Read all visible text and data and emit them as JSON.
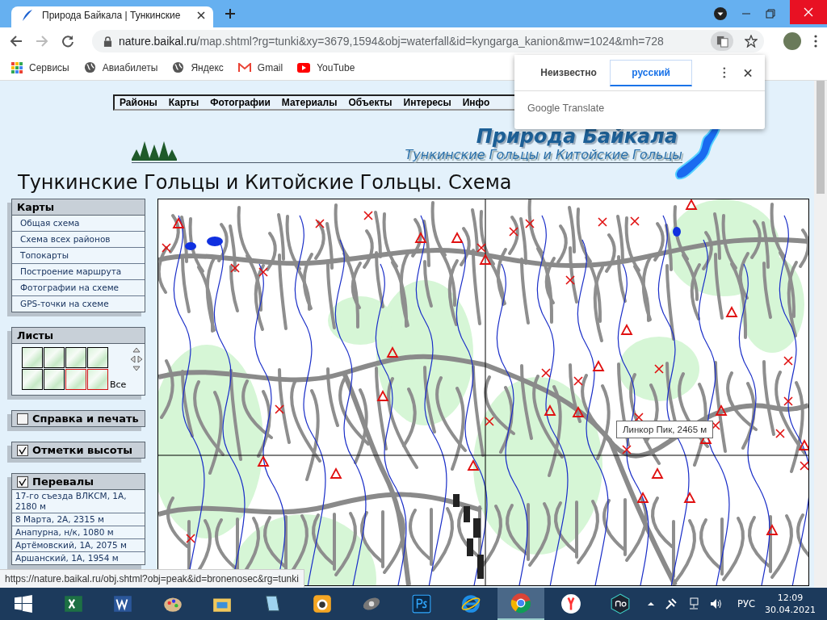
{
  "browser": {
    "tab": {
      "title": "Природа Байкала | Тункинские"
    },
    "url": {
      "host": "nature.baikal.ru",
      "path": "/map.shtml?rg=tunki&xy=3679,1594&obj=waterfall&id=kyngarga_kanion&mw=1024&mh=728"
    },
    "bookmarks": [
      {
        "label": "Сервисы",
        "kind": "apps"
      },
      {
        "label": "Авиабилеты",
        "kind": "globe"
      },
      {
        "label": "Яндекс",
        "kind": "globe"
      },
      {
        "label": "Gmail",
        "kind": "gmail"
      },
      {
        "label": "YouTube",
        "kind": "youtube"
      }
    ],
    "translate": {
      "languages": [
        {
          "label": "Неизвестно",
          "selected": false
        },
        {
          "label": "русский",
          "selected": true
        }
      ],
      "brand": "Google Translate"
    }
  },
  "page": {
    "menu": [
      "Районы",
      "Карты",
      "Фотографии",
      "Материалы",
      "Объекты",
      "Интересы",
      "Инфо"
    ],
    "site_title": "Природа Байкала",
    "site_subtitle": "Тункинские Гольцы и Китойские Гольцы",
    "heading": "Тункинские Гольцы и Китойские Гольцы. Схема",
    "sidebar": {
      "maps": {
        "title": "Карты",
        "items": [
          "Общая схема",
          "Схема всех районов",
          "Топокарты",
          "Построение маршрута",
          "Фотографии на схеме",
          "GPS-точки на схеме"
        ]
      },
      "sheets": {
        "title": "Листы",
        "all_label": "Все",
        "tiles": [
          {
            "selected": false
          },
          {
            "selected": false
          },
          {
            "selected": false
          },
          {
            "selected": false
          },
          {
            "selected": false
          },
          {
            "selected": false
          },
          {
            "selected": true
          },
          {
            "selected": true
          }
        ]
      },
      "toggles": [
        {
          "label": "Справка и печать",
          "checked": false
        },
        {
          "label": "Отметки высоты",
          "checked": true
        }
      ],
      "passes": {
        "title": "Перевалы",
        "checked": true,
        "items": [
          "17-го съезда ВЛКСМ, 1А, 2180 м",
          "8 Марта, 2А, 2315 м",
          "Анапурна, н/к, 1080 м",
          "Артёмовский, 1А, 2075 м",
          "Аршанский, 1А, 1954 м"
        ]
      }
    },
    "map": {
      "tooltip": "Линкор Пик, 2465 м"
    },
    "status_url": "https://nature.baikal.ru/obj.shtml?obj=peak&id=bronenosec&rg=tunki"
  },
  "taskbar": {
    "apps": [
      {
        "kind": "excel",
        "active": false
      },
      {
        "kind": "word",
        "active": false
      },
      {
        "kind": "paint",
        "active": false
      },
      {
        "kind": "explorer",
        "active": false
      },
      {
        "kind": "notepad",
        "active": false
      },
      {
        "kind": "camera",
        "active": false
      },
      {
        "kind": "media",
        "active": false
      },
      {
        "kind": "photoshop",
        "active": false
      },
      {
        "kind": "ie",
        "active": false
      },
      {
        "kind": "chrome",
        "active": true
      },
      {
        "kind": "yandex",
        "active": false
      },
      {
        "kind": "nox",
        "active": false
      }
    ],
    "tray": {
      "language": "РУС",
      "time": "12:09",
      "date": "30.04.2021"
    }
  }
}
